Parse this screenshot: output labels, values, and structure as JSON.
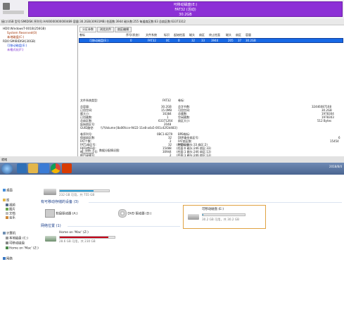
{
  "diskgenius": {
    "disk_title": "可移动磁盘(E:)",
    "disk_fs": "FAT32 (活动)",
    "disk_size": "30.2GB",
    "info_bar": "接口:USB  型号:SMIDISK  序列号:AA00000000000489  容量:30.2GB(30931MB)  柱面数:3944  磁头数:255  每道扇区数:63  总扇区数:63373312",
    "tree": [
      "HD0:WindowsT-001B(256GB)",
      "System Reserved(0)",
      "本地磁盘(C:)",
      "RD0:SMIBIDISK(30GB)",
      "可移动磁盘(E:)",
      "未格式化(F:)"
    ],
    "tabs": [
      "分区参数",
      "浏览文件",
      "扇区编辑"
    ],
    "partition_headers": [
      "卷标",
      "序号(状态)",
      "文件系统",
      "标识",
      "起始柱面",
      "磁头",
      "扇区",
      "终止柱面",
      "磁头",
      "扇区",
      "容量"
    ],
    "partition_row": [
      "可移动磁盘(E:)",
      "0",
      "FAT32",
      "0C",
      "0",
      "32",
      "33",
      "3944",
      "205",
      "37",
      "30.2GB"
    ],
    "details_left": [
      [
        "文件系统类型:",
        "FAT32"
      ],
      [
        "总容量:",
        "30.2GB"
      ],
      [
        "已用空间:",
        "15.0MB"
      ],
      [
        "簇大小:",
        "16384"
      ],
      [
        "已用簇数:",
        "1"
      ],
      [
        "总扇区数:",
        "63371264"
      ],
      [
        "起始扇区号:",
        "2048"
      ],
      [
        "GUID路径:",
        "\\\\?\\Volume{8a06fcce-9422-11e8-a4a5-001c42f2d483}"
      ]
    ],
    "details_right": [
      [
        "卷标:",
        ""
      ],
      [
        "总字节数:",
        "32446087168"
      ],
      [
        "可用空间:",
        "30.2GB"
      ],
      [
        "总簇数:",
        "1978304"
      ],
      [
        "空闲簇数:",
        "1978303"
      ],
      [
        "扇区大小:",
        "512 Bytes"
      ]
    ],
    "fat_left": [
      [
        "卷序列号:",
        "0BC1-8279"
      ],
      [
        "保留扇区数:",
        "32"
      ],
      [
        "FAT个数:",
        "2"
      ],
      [
        "FAT1扇区号:",
        "32"
      ],
      [
        "FAT2扇区号:",
        "15488"
      ],
      [
        "根目录扇区号:",
        "30944"
      ],
      [
        "根目录簇号:",
        "2"
      ],
      [
        "数据起始扇区号:",
        "30944"
      ]
    ],
    "fat_mid": [
      "(柱面:0 磁头:33 扇区:2)",
      "(柱面:0 磁头:246 扇区:33)",
      "(柱面:1 磁头:246 扇区:13)",
      "(柱面:1 磁头:246 扇区:13)",
      "",
      "(柱面:1 磁头:53 扇区:62)"
    ],
    "fat_right": [
      [
        "BPB卷标:",
        ""
      ],
      [
        "DBR备份扇区号:",
        "6"
      ],
      [
        "FAT扇区数:",
        "15454"
      ],
      [
        "FAT标志:",
        ""
      ]
    ],
    "analyze_button": "分析",
    "data_map_label": "数据分配情况图:",
    "status": "就绪"
  },
  "taskbar": {
    "clock": "2018/8/4"
  },
  "explorer": {
    "sidebar": [
      "桌面",
      "库",
      "视频",
      "图片",
      "文档",
      "音乐",
      "计算机",
      "本地磁盘 (C:)",
      "可移动磁盘",
      "Home on 'Mac' (Z:)",
      "网络"
    ],
    "top_size": "232 GB 可用，共 755 GB",
    "group_removable": "有可移动存储的设备 (3)",
    "drives": [
      {
        "name": "软盘驱动器 (A:)",
        "size": ""
      },
      {
        "name": "DVD 驱动器 (D:)",
        "size": ""
      },
      {
        "name": "可移动磁盘 (E:)",
        "size": "30.2 GB 可用，共 30.2 GB",
        "used": 0.01
      }
    ],
    "group_network": "网络位置 (1)",
    "network_drive": {
      "name": "Home on 'Mac' (Z:)",
      "size": "28.6 GB 可用，共 230 GB",
      "used": 0.88
    },
    "colors": {
      "accent_border": "#e0a343",
      "bar_fill_blue": "#26a0da",
      "bar_fill_red": "#c4001a"
    }
  }
}
